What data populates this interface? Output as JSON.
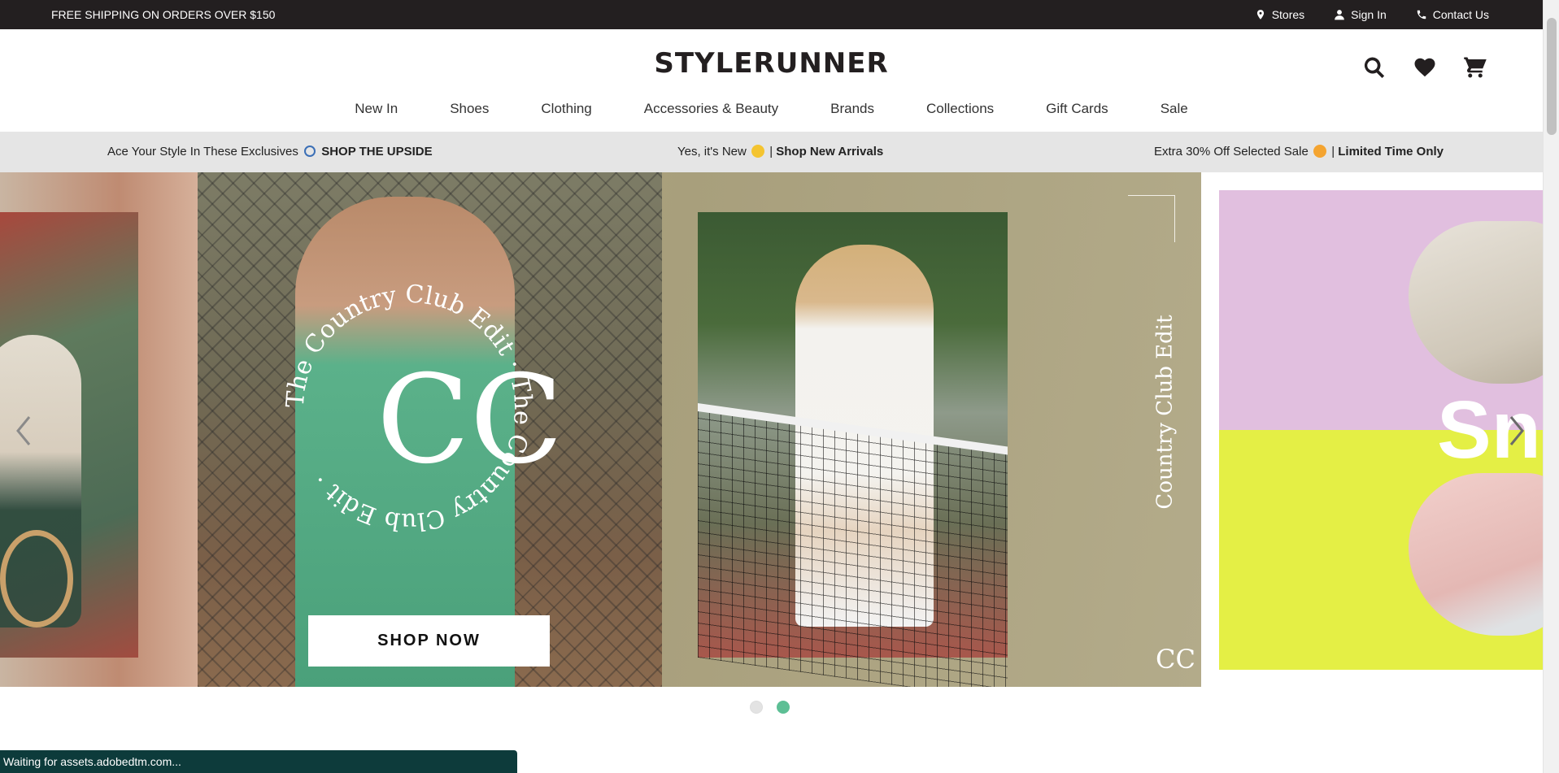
{
  "topbar": {
    "shipping": "FREE SHIPPING ON ORDERS OVER $150",
    "stores": "Stores",
    "sign_in": "Sign In",
    "contact": "Contact Us"
  },
  "header": {
    "logo": "STYLERUNNER",
    "icons": [
      "search-icon",
      "heart-icon",
      "cart-icon"
    ]
  },
  "nav": {
    "items": [
      "New In",
      "Shoes",
      "Clothing",
      "Accessories & Beauty",
      "Brands",
      "Collections",
      "Gift Cards",
      "Sale"
    ]
  },
  "promo": {
    "p1_text": "Ace Your Style In These Exclusives",
    "p1_link": "SHOP THE UPSIDE",
    "p2_text": "Yes, it's New",
    "p2_sep": "|",
    "p2_link": "Shop New Arrivals",
    "p3_text": "Extra 30% Off Selected Sale",
    "p3_sep": "|",
    "p3_link": "Limited Time Only"
  },
  "hero": {
    "ring_text": "The Country Club Edit · The Country Club Edit ·",
    "monogram": "CC",
    "vertical_text": "Country Club Edit",
    "shop_button": "SHOP NOW",
    "right_slide_letters": "Sn",
    "active_slide": 2,
    "slide_count": 2
  },
  "status": {
    "text": "Waiting for assets.adobedtm.com..."
  },
  "colors": {
    "topbar": "#231f20",
    "promo_bg": "#e5e5e5",
    "dot_active": "#5dbf95",
    "status_bg": "#0d3b3b"
  }
}
